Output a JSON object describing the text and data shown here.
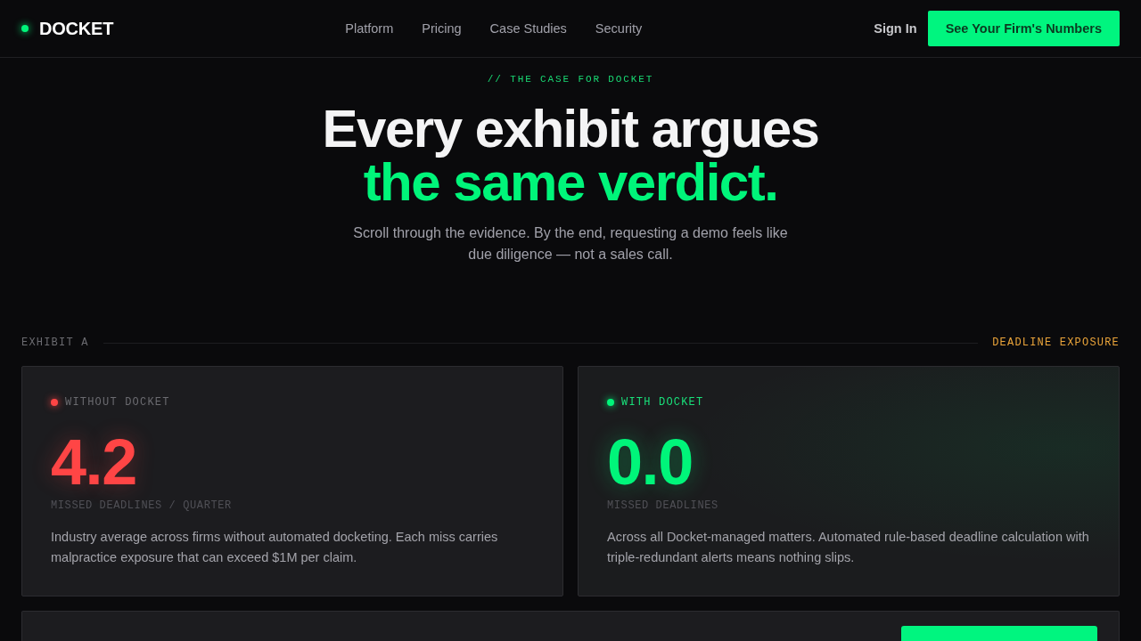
{
  "nav": {
    "logo": "DOCKET",
    "links": [
      "Platform",
      "Pricing",
      "Case Studies",
      "Security"
    ],
    "sign_in": "Sign In",
    "cta": "See Your Firm's Numbers"
  },
  "hero": {
    "eyebrow": "// THE CASE FOR DOCKET",
    "title_line_1": "Every exhibit argues",
    "title_line_2": "the same verdict.",
    "subtitle": "Scroll through the evidence. By the end, requesting a demo feels like due diligence — not a sales call."
  },
  "exhibit": {
    "label": "EXHIBIT A",
    "topic": "DEADLINE EXPOSURE",
    "cards": [
      {
        "kind": "negative",
        "label": "WITHOUT DOCKET",
        "color": "#ff4545",
        "value": "4.2",
        "unit": "MISSED DEADLINES / QUARTER",
        "description": "Industry average across firms without automated docketing. Each miss carries malpractice exposure that can exceed $1M per claim."
      },
      {
        "kind": "positive",
        "label": "WITH DOCKET",
        "color": "#00f57a",
        "value": "0.0",
        "unit": "MISSED DEADLINES",
        "description": "Across all Docket-managed matters. Automated rule-based deadline calculation with triple-redundant alerts means nothing slips."
      }
    ]
  }
}
